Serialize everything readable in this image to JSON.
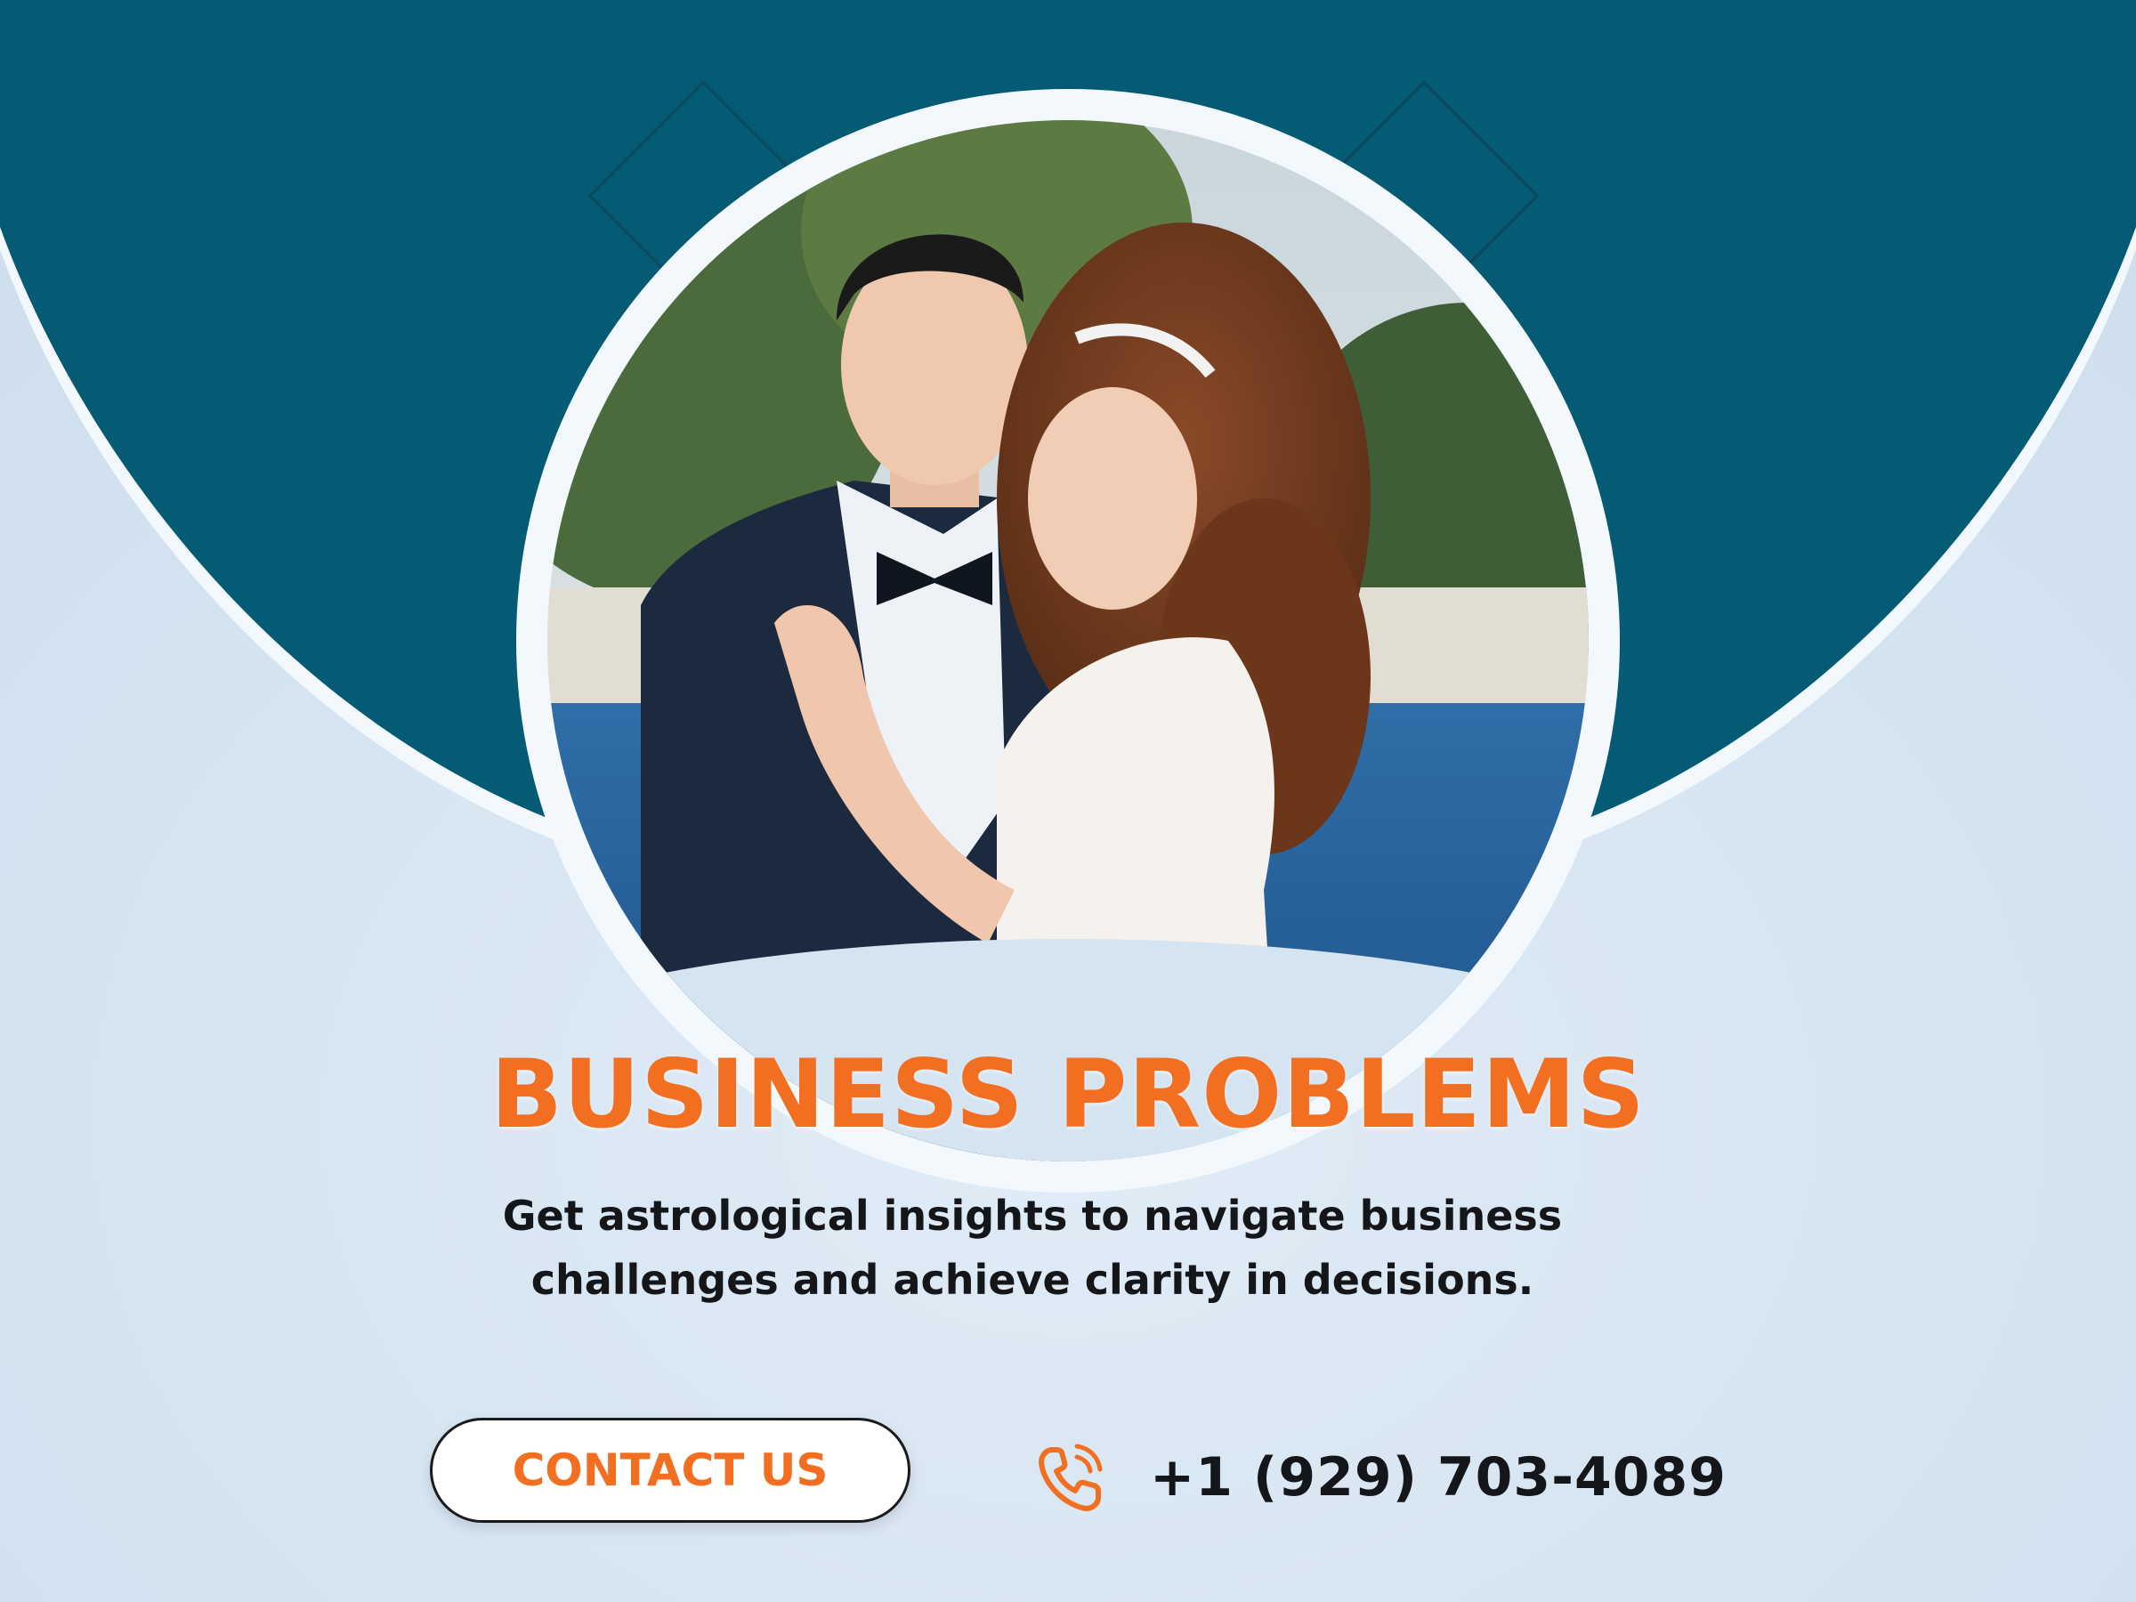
{
  "headline": "BUSINESS PROBLEMS",
  "description": "Get astrological insights to navigate business challenges and achieve clarity in decisions.",
  "cta": {
    "label": "CONTACT US"
  },
  "phone": {
    "number": "+1 (929) 703-4089",
    "icon": "phone-icon"
  },
  "photo": {
    "subject": "wedding-couple-photo"
  },
  "colors": {
    "primary_dark": "#055b73",
    "background_light": "#d5e4f1",
    "accent_orange": "#f26f21",
    "text_dark": "#14161a"
  }
}
